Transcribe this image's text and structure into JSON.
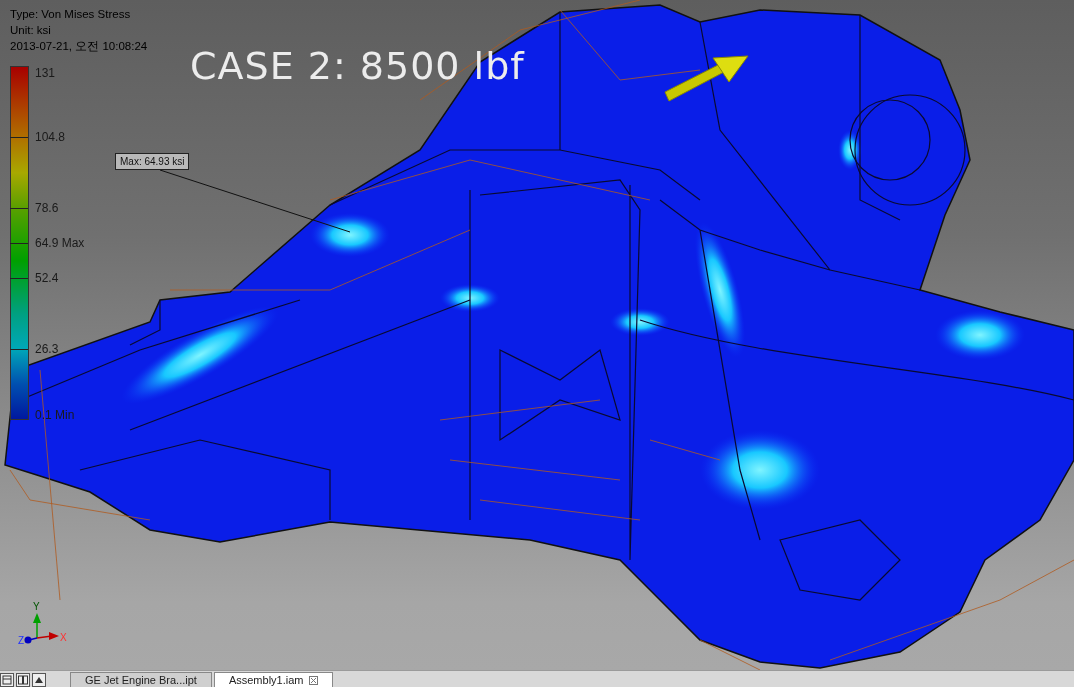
{
  "result_info": {
    "type": "Type: Von Mises Stress",
    "unit": "Unit: ksi",
    "timestamp": "2013-07-21, 오전 10:08:24"
  },
  "title": "CASE 2: 8500 lbf",
  "legend": {
    "ticks": [
      {
        "label": "131",
        "kind": "band"
      },
      {
        "label": "104.8",
        "kind": "band"
      },
      {
        "label": "78.6",
        "kind": "band"
      },
      {
        "label": "64.9 Max",
        "kind": "marker"
      },
      {
        "label": "52.4",
        "kind": "band"
      },
      {
        "label": "26.3",
        "kind": "band"
      },
      {
        "label": "0.1 Min",
        "kind": "band"
      }
    ]
  },
  "probe": {
    "label": "Max: 64.93 ksi"
  },
  "axis_triad": {
    "labels": [
      "X",
      "Y",
      "Z"
    ]
  },
  "document_tabs": [
    {
      "label": "GE Jet Engine Bra...ipt",
      "selected": false
    },
    {
      "label": "Assembly1.iam",
      "selected": true
    }
  ]
}
